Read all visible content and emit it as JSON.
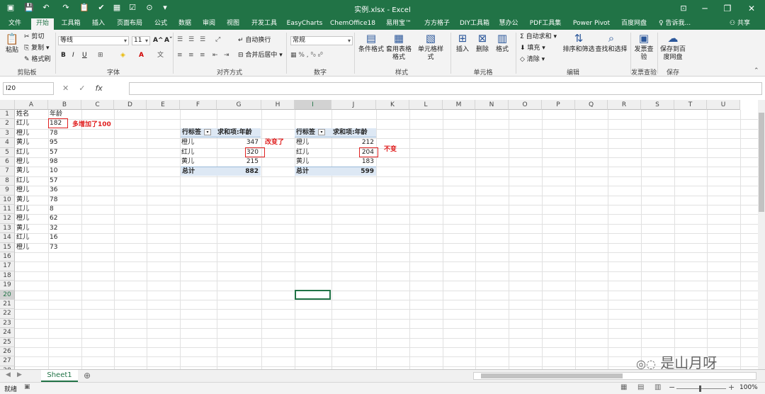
{
  "window": {
    "title": "实例.xlsx - Excel",
    "minimize": "─",
    "restore": "❐",
    "close": "✕",
    "restore_ribbon": "⊡"
  },
  "tabs": [
    "文件",
    "开始",
    "工具箱",
    "插入",
    "页面布局",
    "公式",
    "数据",
    "审阅",
    "视图",
    "开发工具",
    "EasyCharts",
    "ChemOffice18",
    "易用宝™",
    "方方格子",
    "DIY工具箱",
    "慧办公",
    "PDF工具集",
    "Power Pivot",
    "百度网盘"
  ],
  "tell_me": "告诉我...",
  "share": "共享",
  "ribbon": {
    "clipboard": {
      "paste": "粘贴",
      "cut": "剪切",
      "copy": "复制",
      "format_painter": "格式刷",
      "label": "剪贴板"
    },
    "font": {
      "name": "等线",
      "size": "11",
      "bold": "B",
      "italic": "I",
      "underline": "U",
      "grow": "A^",
      "shrink": "Aˇ",
      "label": "字体"
    },
    "alignment": {
      "wrap": "自动换行",
      "merge": "合并后居中",
      "label": "对齐方式"
    },
    "number": {
      "format": "常规",
      "label": "数字"
    },
    "styles": {
      "conditional": "条件格式",
      "table": "套用表格格式",
      "cell": "单元格样式",
      "label": "样式"
    },
    "cells": {
      "insert": "插入",
      "delete": "删除",
      "format": "格式",
      "label": "单元格"
    },
    "editing": {
      "autosum": "自动求和",
      "fill": "填充",
      "clear": "清除",
      "sort": "排序和筛选",
      "find": "查找和选择",
      "label": "编辑"
    },
    "invoice": {
      "check": "发票查验",
      "label": "发票查验"
    },
    "save": {
      "baidu": "保存到百度网盘",
      "label": "保存"
    }
  },
  "formula_bar": {
    "name_box": "I20",
    "fx": "fx",
    "value": ""
  },
  "columns": [
    "A",
    "B",
    "C",
    "D",
    "E",
    "F",
    "G",
    "H",
    "I",
    "J",
    "K",
    "L",
    "M",
    "N",
    "O",
    "P",
    "Q",
    "R",
    "S",
    "T",
    "U"
  ],
  "rows": [
    "1",
    "2",
    "3",
    "4",
    "5",
    "6",
    "7",
    "8",
    "9",
    "10",
    "11",
    "12",
    "13",
    "14",
    "15",
    "16",
    "17",
    "18",
    "19",
    "20",
    "21",
    "22",
    "23",
    "24",
    "25",
    "26",
    "27",
    "28"
  ],
  "source_table": {
    "header": [
      "姓名",
      "年龄"
    ],
    "rows": [
      [
        "红儿",
        "182"
      ],
      [
        "橙儿",
        "78"
      ],
      [
        "黄儿",
        "95"
      ],
      [
        "红儿",
        "57"
      ],
      [
        "橙儿",
        "98"
      ],
      [
        "黄儿",
        "10"
      ],
      [
        "红儿",
        "57"
      ],
      [
        "橙儿",
        "36"
      ],
      [
        "黄儿",
        "78"
      ],
      [
        "红儿",
        "8"
      ],
      [
        "橙儿",
        "62"
      ],
      [
        "黄儿",
        "32"
      ],
      [
        "红儿",
        "16"
      ],
      [
        "橙儿",
        "73"
      ]
    ]
  },
  "pivot1": {
    "head_label": "行标签",
    "head_value": "求和项:年龄",
    "rows": [
      [
        "橙儿",
        "347"
      ],
      [
        "红儿",
        "320"
      ],
      [
        "黄儿",
        "215"
      ]
    ],
    "total_label": "总计",
    "total_value": "882"
  },
  "pivot2": {
    "head_label": "行标签",
    "head_value": "求和项:年龄",
    "rows": [
      [
        "橙儿",
        "212"
      ],
      [
        "红儿",
        "204"
      ],
      [
        "黄儿",
        "183"
      ]
    ],
    "total_label": "总计",
    "total_value": "599"
  },
  "annotations": {
    "b2_note": "多增加了100",
    "pivot1_note": "改变了",
    "pivot2_note": "不变"
  },
  "sheet_tab": "Sheet1",
  "status": {
    "ready": "就绪",
    "zoom": "100%"
  },
  "watermark": "是山月呀",
  "colors": {
    "excel_green": "#217346",
    "annotation_red": "#e02020",
    "pivot_header": "#dde8f4"
  }
}
